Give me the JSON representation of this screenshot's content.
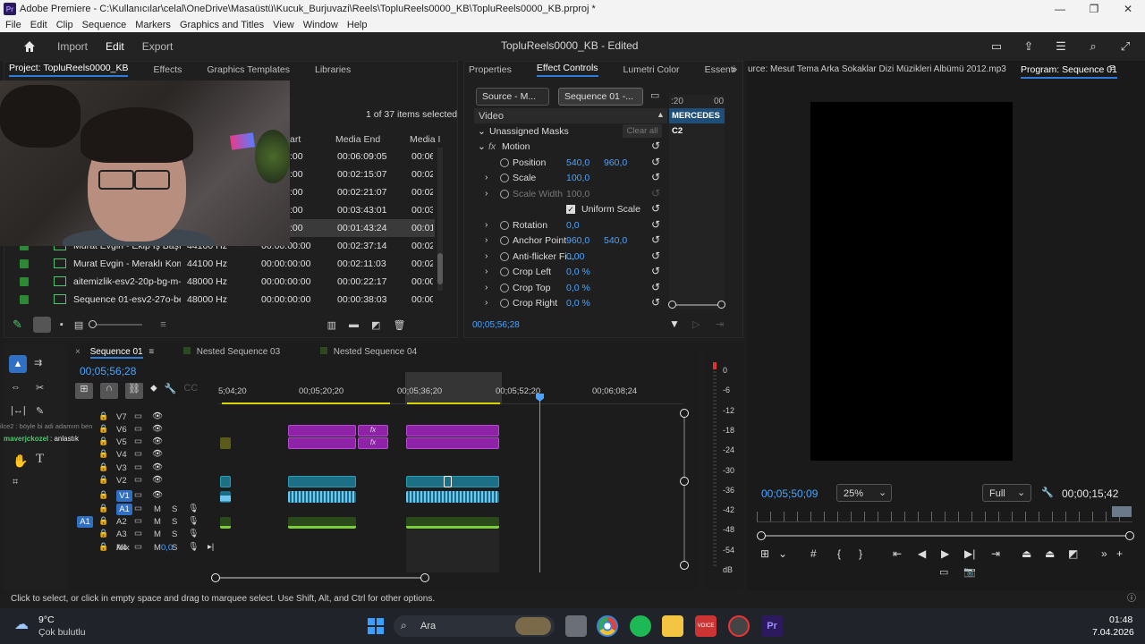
{
  "titlebar": {
    "title": "Adobe Premiere - C:\\Kullanıcılar\\celal\\OneDrive\\Masaüstü\\Kucuk_Burjuvazi\\Reels\\TopluReels0000_KB\\TopluReels0000_KB.prproj *"
  },
  "menu": [
    "File",
    "Edit",
    "Clip",
    "Sequence",
    "Markers",
    "Graphics and Titles",
    "View",
    "Window",
    "Help"
  ],
  "workspace": {
    "tabs": [
      "Import",
      "Edit",
      "Export"
    ],
    "active": "Edit",
    "project_title": "TopluReels0000_KB - Edited"
  },
  "project_panel": {
    "tabs": [
      "Project: TopluReels0000_KB",
      "Effects",
      "Graphics Templates",
      "Libraries"
    ],
    "count": "1 of 37 items selected",
    "columns": [
      "art",
      "Media End",
      "Media I"
    ],
    "partial_rows": [
      {
        "start": ":00",
        "end": "00:06:09:05",
        "dur": "00:06"
      },
      {
        "start": ":00",
        "end": "00:02:15:07",
        "dur": "00:02"
      },
      {
        "start": ":00",
        "end": "00:02:21:07",
        "dur": "00:02"
      },
      {
        "start": ":00",
        "end": "00:03:43:01",
        "dur": "00:03"
      },
      {
        "start": ":00",
        "end": "00:01:43:24",
        "dur": "00:01"
      }
    ],
    "rows": [
      {
        "name": "Murat Evgin - Ekip İş Başında",
        "rate": "44100 Hz",
        "start": "00:00:00:00",
        "end": "00:02:37:14",
        "dur": "00:02"
      },
      {
        "name": "Murat Evgin - Meraklı Kome",
        "rate": "44100 Hz",
        "start": "00:00:00:00",
        "end": "00:02:11:03",
        "dur": "00:02"
      },
      {
        "name": "aitemizlik-esv2-20p-bg-m-m",
        "rate": "48000 Hz",
        "start": "00:00:00:00",
        "end": "00:00:22:17",
        "dur": "00:00"
      },
      {
        "name": "Sequence 01-esv2-27o-be-m",
        "rate": "48000 Hz",
        "start": "00:00:00:00",
        "end": "00:00:38:03",
        "dur": "00:00"
      }
    ]
  },
  "effect_controls": {
    "tabs": [
      "Properties",
      "Effect Controls",
      "Lumetri Color",
      "Essenti"
    ],
    "source_btn": "Source - M...",
    "seq_btn": "Sequence 01 -...",
    "section": "Video",
    "masks": "Unassigned Masks",
    "clear_all": "Clear all",
    "motion": "Motion",
    "props": [
      {
        "label": "Position",
        "v1": "540,0",
        "v2": "960,0"
      },
      {
        "label": "Scale",
        "v1": "100,0",
        "v2": ""
      },
      {
        "label": "Scale Width",
        "v1": "100,0",
        "v2": ""
      },
      {
        "label": "Uniform Scale",
        "v1": "",
        "v2": ""
      },
      {
        "label": "Rotation",
        "v1": "0,0",
        "v2": ""
      },
      {
        "label": "Anchor Point",
        "v1": "960,0",
        "v2": "540,0"
      },
      {
        "label": "Anti-flicker Fi...",
        "v1": "0,00",
        "v2": ""
      },
      {
        "label": "Crop Left",
        "v1": "0,0 %",
        "v2": ""
      },
      {
        "label": "Crop Top",
        "v1": "0,0 %",
        "v2": ""
      },
      {
        "label": "Crop Right",
        "v1": "0,0 %",
        "v2": ""
      }
    ],
    "timeline_time": ":20",
    "timeline_time2": "00",
    "mercedes": "MERCEDES C2",
    "timecode": "00;05;56;28"
  },
  "program": {
    "source_label": "urce: Mesut Tema  Arka Sokaklar Dizi Müzikleri Albümü  2012.mp3",
    "title": "Program: Sequence 01",
    "timecode": "00;05;50;09",
    "zoom": "25%",
    "quality": "Full",
    "duration": "00;00;15;42"
  },
  "timeline": {
    "tabs": [
      "Sequence 01",
      "Nested Sequence 03",
      "Nested Sequence 04"
    ],
    "timecode": "00;05;56;28",
    "ruler": [
      "5;04;20",
      "00;05;20;20",
      "00;05;36;20",
      "00;05;52;20",
      "00;06;08;24"
    ],
    "tracks": [
      "V7",
      "V6",
      "V5",
      "V4",
      "V3",
      "V2",
      "V1",
      "A1",
      "A2",
      "A3",
      "A4",
      "Mix"
    ],
    "mix_value": "0,0",
    "chat1": "ilce2 : böyle bi adi adamım ben",
    "chat2": "maverjckozel",
    "chat3": ": anlastık",
    "meter_labels": [
      "0",
      "-6",
      "-12",
      "-18",
      "-24",
      "-30",
      "-36",
      "-42",
      "-48",
      "-54",
      "dB"
    ]
  },
  "status": "Click to select, or click in empty space and drag to marquee select. Use Shift, Alt, and Ctrl for other options.",
  "taskbar": {
    "temp": "9°C",
    "weather": "Çok bulutlu",
    "search": "Ara",
    "time": "01:48",
    "date": "7.04.2026"
  },
  "colors": {
    "accent": "#2f7bd8",
    "video_clip": "#8e23a8",
    "audio_clip": "#1a6b86",
    "playhead": "#4aa3ff"
  }
}
